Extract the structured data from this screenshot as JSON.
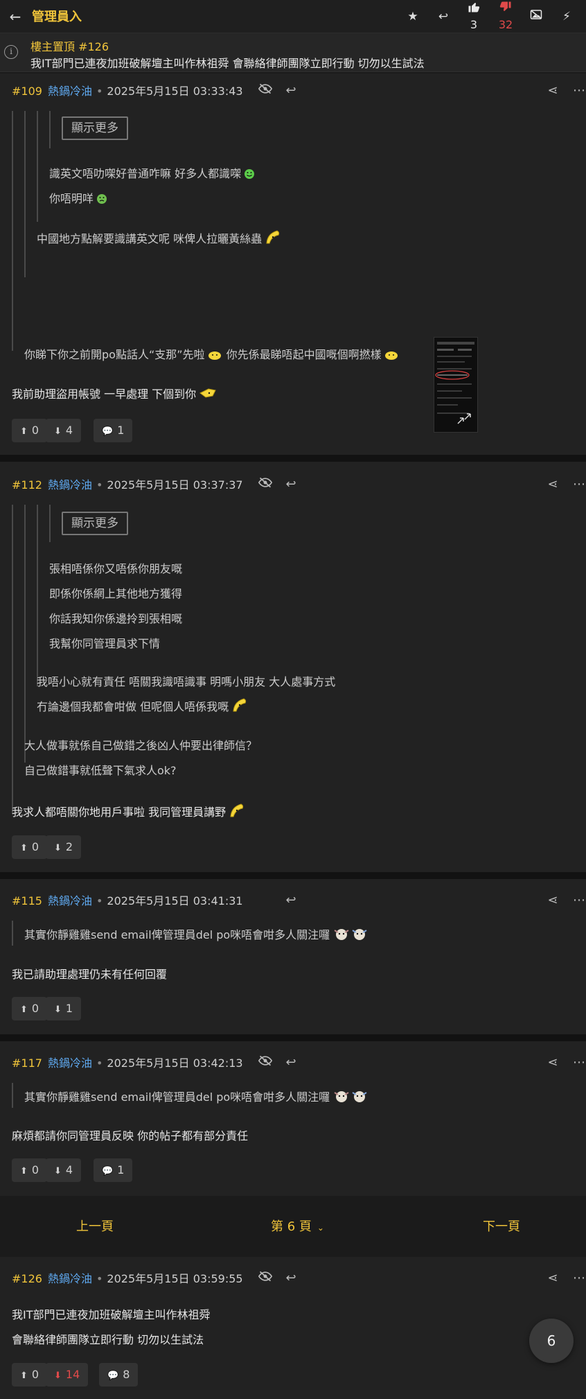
{
  "topbar": {
    "title": "管理員入",
    "likes": "3",
    "dislikes": "32",
    "colors": {
      "accent": "#f0c43a",
      "dislike": "#e04a4a",
      "user": "#5fa9f0"
    }
  },
  "pinned": {
    "label": "樓主置頂   #126",
    "text": "我IT部門已連夜加班破解壇主叫作林祖舜 會聯絡律師團隊立即行動 切勿以生試法"
  },
  "posts": [
    {
      "num": "#109",
      "name": "熱鍋冷油",
      "time": "2025年5月15日 03:33:43",
      "show_more": "顯示更多",
      "q3": [
        "識英文唔叻㗎好普通咋嘛 好多人都識㗎",
        "你唔明咩"
      ],
      "q2": [
        "中國地方點解要識講英文呢 咪俾人拉曬黃絲蟲"
      ],
      "q1": [
        "你睇下你之前開po點話人“支那”先啦",
        "你先係最睇唔起中國嘅個啊撚樣"
      ],
      "body": [
        "我前助理盜用帳號 一早處理 下個到你"
      ],
      "up": "0",
      "down": "4",
      "comments": "1"
    },
    {
      "num": "#112",
      "name": "熱鍋冷油",
      "time": "2025年5月15日 03:37:37",
      "show_more": "顯示更多",
      "q3": [
        "張相唔係你又唔係你朋友嘅",
        "即係你係網上其他地方獲得",
        "你話我知你係邊拎到張相嘅",
        "我幫你同管理員求下情"
      ],
      "q2": [
        "我唔小心就有責任 唔關我識唔識事 明嗎小朋友 大人處事方式",
        "冇論邊個我都會咁做 但呢個人唔係我嘅"
      ],
      "q1": [
        "大人做事就係自己做錯之後凶人仲要出律師信？",
        "自己做錯事就低聲下氣求人ok?"
      ],
      "body": [
        "我求人都唔關你地用戶事啦 我同管理員講野"
      ],
      "up": "0",
      "down": "2"
    },
    {
      "num": "#115",
      "name": "熱鍋冷油",
      "time": "2025年5月15日 03:41:31",
      "q1": [
        "其實你靜雞雞send email俾管理員del po咪唔會咁多人關注囉"
      ],
      "body": [
        "我已請助理處理仍未有任何回覆"
      ],
      "up": "0",
      "down": "1"
    },
    {
      "num": "#117",
      "name": "熱鍋冷油",
      "time": "2025年5月15日 03:42:13",
      "q1": [
        "其實你靜雞雞send email俾管理員del po咪唔會咁多人關注囉"
      ],
      "body": [
        "麻煩都請你同管理員反映 你的帖子都有部分責任"
      ],
      "up": "0",
      "down": "4",
      "comments": "1"
    },
    {
      "num": "#126",
      "name": "熱鍋冷油",
      "time": "2025年5月15日 03:59:55",
      "body": [
        "我IT部門已連夜加班破解壇主叫作林祖舜",
        "會聯絡律師團隊立即行動 切勿以生試法"
      ],
      "up": "0",
      "down": "14",
      "comments": "8"
    }
  ],
  "pager": {
    "prev": "上一頁",
    "current": "第 6 頁",
    "next": "下一頁"
  },
  "fab": {
    "page": "6"
  }
}
